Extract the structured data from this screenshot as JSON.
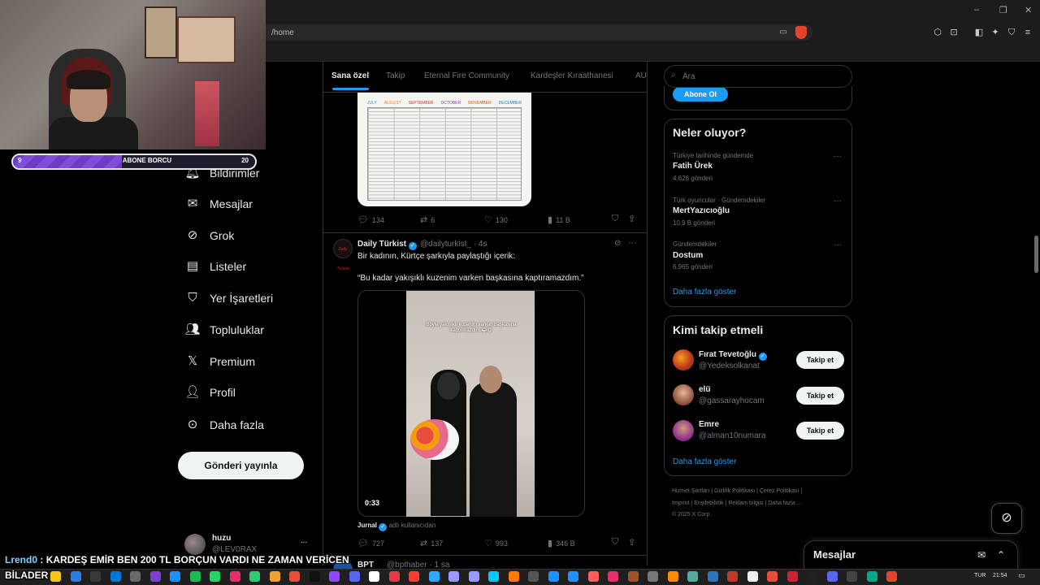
{
  "browser": {
    "url": "/home",
    "window_controls": [
      "–",
      "❐",
      "✕"
    ]
  },
  "stream_overlay": {
    "progress_title": "ABONE BORCU",
    "progress_current": "9",
    "progress_target": "20",
    "progress_fraction": 0.45,
    "chat_user": "Lrend0",
    "chat_message": ": KARDEŞ EMİR BEN 200 TL BORÇUN VARDI NE ZAMAN VERİCEN",
    "chat_message_2": "BİLADER"
  },
  "nav": {
    "items": [
      {
        "label": "Bildirimler",
        "icon": "bell-icon"
      },
      {
        "label": "Mesajlar",
        "icon": "envelope-icon"
      },
      {
        "label": "Grok",
        "icon": "grok-icon"
      },
      {
        "label": "Listeler",
        "icon": "list-icon"
      },
      {
        "label": "Yer İşaretleri",
        "icon": "bookmark-icon"
      },
      {
        "label": "Topluluklar",
        "icon": "communities-icon"
      },
      {
        "label": "Premium",
        "icon": "x-logo-icon"
      },
      {
        "label": "Profil",
        "icon": "person-icon"
      },
      {
        "label": "Daha fazla",
        "icon": "more-circle-icon"
      }
    ],
    "post_button": "Gönderi yayınla",
    "account_name": "huzu",
    "account_handle": "@LEV0RAX",
    "account_more": "..."
  },
  "tabs": [
    "Sana özel",
    "Takip",
    "Eternal Fire Community",
    "Kardeşler Kıraathanesi",
    "AU"
  ],
  "calendar_months": [
    "JULY",
    "AUGUST",
    "SEPTEMBER",
    "OCTOBER",
    "NOVEMBER",
    "DECEMBER"
  ],
  "tweet1_actions": {
    "replies": "134",
    "retweets": "6",
    "likes": "130",
    "views": "11 B"
  },
  "tweet2": {
    "name": "Daily Türkist",
    "avatar_text": "Daily Türkist",
    "handle": "@dailyturkist_ · 4s",
    "text": "Bir kadının, Kürtçe şarkıyla paylaştığı içerik:",
    "quote": "“Bu kadar yakışıklı kuzenim varken başkasına kaptıramazdım.”",
    "video_caption": "Böyle yakışıklı kuzenim varken başkasına kaptırmazdım.😂😍",
    "video_time": "0:33",
    "source_name": "Jurnal",
    "source_suffix": "adlı kullanıcıdan",
    "replies": "727",
    "retweets": "137",
    "likes": "993",
    "views": "346 B",
    "more": "···"
  },
  "tweet3": {
    "name": "BPT",
    "handle": "@bpthaber · 1 sa"
  },
  "right": {
    "search_placeholder": "Ara",
    "subscribe_button": "Abone Ol",
    "trends_title": "Neler oluyor?",
    "trends": [
      {
        "context": "Türkiye tarihinde gündemde",
        "name": "Fatih Ürek",
        "count": "4.626 gönderi"
      },
      {
        "context": "Türk oyuncular · Gündemdekiler",
        "name": "MertYazıcıoğlu",
        "count": "10,9 B gönderi"
      },
      {
        "context": "Gündemdekiler",
        "name": "Dostum",
        "count": "6.965 gönderi"
      }
    ],
    "trends_more": "Daha fazla göster",
    "wtf_title": "Kimi takip etmeli",
    "wtf": [
      {
        "name": "Fırat Tevetoğlu",
        "handle": "@Yedeksolkanat",
        "button": "Takip et",
        "verified": true
      },
      {
        "name": "elü",
        "handle": "@gassarayhocam",
        "button": "Takip et",
        "verified": false
      },
      {
        "name": "Emre",
        "handle": "@alman10numara",
        "button": "Takip et",
        "verified": false
      }
    ],
    "wtf_more": "Daha fazla göster",
    "footer_line1": "Hizmet Şartları  |  Gizlilik Politikası  |  Çerez Politikası  |",
    "footer_line2": "Imprint  |  Erişilebilirlik  |  Reklam bilgisi  |  Daha fazla ...",
    "footer_line3": "© 2025 X Corp."
  },
  "messages_drawer": {
    "title": "Mesajlar"
  },
  "taskbar": {
    "lang": "TUR",
    "time": "21:54"
  }
}
